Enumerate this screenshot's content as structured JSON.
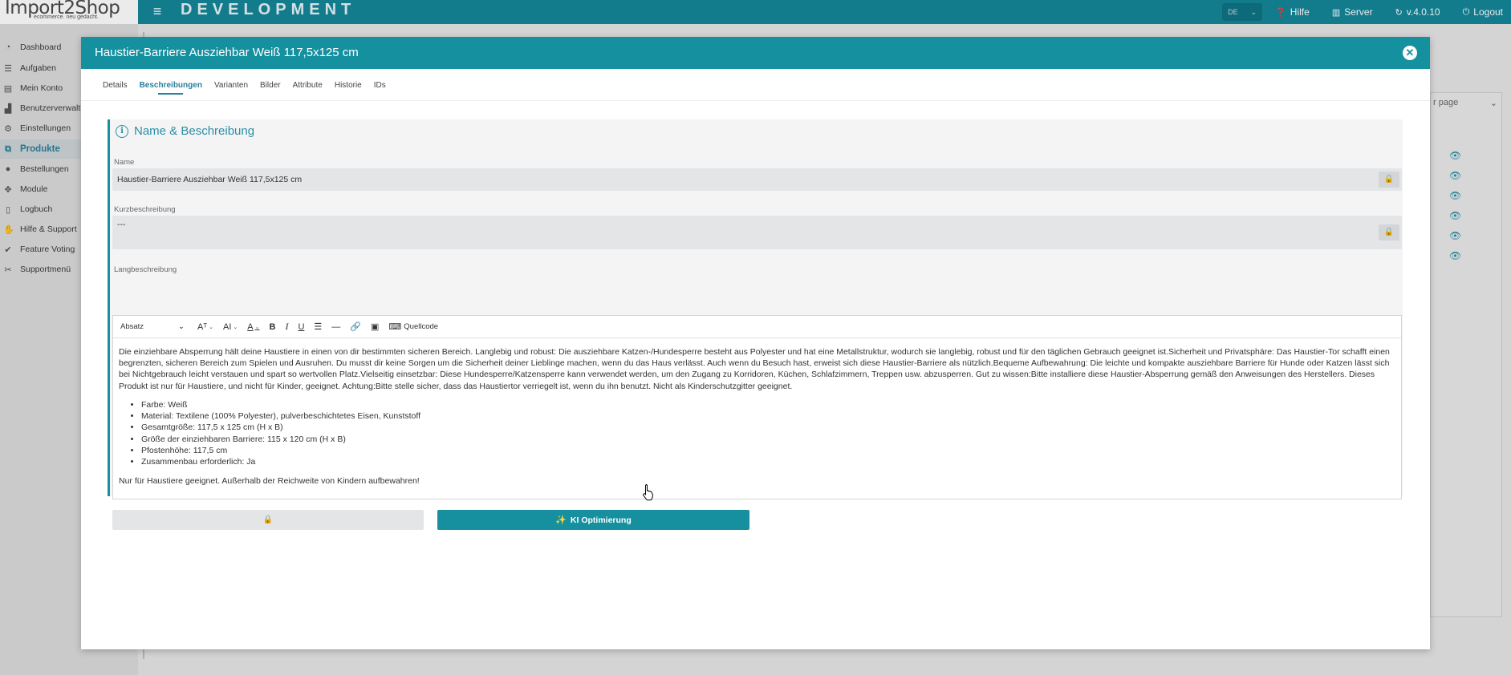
{
  "topbar": {
    "logo": "Import2Shop",
    "logo_tagline": "ecommerce. neu gedacht.",
    "env_title": "DEVELOPMENT",
    "language": "DE",
    "help_label": "Hilfe",
    "server_label": "Server",
    "version_label": "v.4.0.10",
    "logout_label": "Logout"
  },
  "sidebar": {
    "items": [
      {
        "label": "Dashboard",
        "icon": "dashboard-icon"
      },
      {
        "label": "Aufgaben",
        "icon": "list-icon"
      },
      {
        "label": "Mein Konto",
        "icon": "book-icon"
      },
      {
        "label": "Benutzerverwaltung",
        "icon": "users-icon"
      },
      {
        "label": "Einstellungen",
        "icon": "gears-icon"
      },
      {
        "label": "Produkte",
        "icon": "sitemap-icon",
        "active": true
      },
      {
        "label": "Bestellungen",
        "icon": "piggy-bank-icon"
      },
      {
        "label": "Module",
        "icon": "puzzle-icon"
      },
      {
        "label": "Logbuch",
        "icon": "file-icon"
      },
      {
        "label": "Hilfe & Support",
        "icon": "hands-helping-icon"
      },
      {
        "label": "Feature Voting",
        "icon": "vote-icon"
      },
      {
        "label": "Supportmenü",
        "icon": "tools-icon"
      }
    ]
  },
  "background": {
    "per_page_label": "r page"
  },
  "modal": {
    "title": "Haustier-Barriere Ausziehbar Weiß 117,5x125 cm",
    "tabs": [
      "Details",
      "Beschreibungen",
      "Varianten",
      "Bilder",
      "Attribute",
      "Historie",
      "IDs"
    ],
    "active_tab": "Beschreibungen",
    "section_title": "Name & Beschreibung",
    "name_label": "Name",
    "name_value": "Haustier-Barriere Ausziehbar Weiß 117,5x125 cm",
    "short_label": "Kurzbeschreibung",
    "short_value": "---",
    "long_label": "Langbeschreibung",
    "toolbar": {
      "paragraph_format": "Absatz",
      "source_label": "Quellcode"
    },
    "long_paragraph": "Die einziehbare Absperrung hält deine Haustiere in einen von dir bestimmten sicheren Bereich. Langlebig und robust: Die ausziehbare Katzen-/Hundesperre besteht aus Polyester und hat eine Metallstruktur, wodurch sie langlebig, robust und für den täglichen Gebrauch geeignet ist.Sicherheit und Privatsphäre: Das Haustier-Tor schafft einen begrenzten, sicheren Bereich zum Spielen und Ausruhen. Du musst dir keine Sorgen um die Sicherheit deiner Lieblinge machen, wenn du das Haus verlässt. Auch wenn du Besuch hast, erweist sich diese Haustier-Barriere als nützlich.Bequeme Aufbewahrung: Die leichte und kompakte ausziehbare Barriere für Hunde oder Katzen lässt sich bei Nichtgebrauch leicht verstauen und spart so wertvollen Platz.Vielseitig einsetzbar: Diese Hundesperre/Katzensperre kann verwendet werden, um den Zugang zu Korridoren, Küchen, Schlafzimmern, Treppen usw. abzusperren. Gut zu wissen:Bitte installiere diese Haustier-Absperrung gemäß den Anweisungen des Herstellers. Dieses Produkt ist nur für Haustiere, und nicht für Kinder, geeignet. Achtung:Bitte stelle sicher, dass das Haustiertor verriegelt ist, wenn du ihn benutzt. Nicht als Kinderschutzgitter geeignet.",
    "bullets": [
      "Farbe: Weiß",
      "Material: Textilene (100% Polyester), pulverbeschichtetes Eisen, Kunststoff",
      "Gesamtgröße: 117,5 x 125 cm (H x B)",
      "Größe der einziehbaren Barriere: 115 x 120 cm (H x B)",
      "Pfostenhöhe: 117,5 cm",
      "Zusammenbau erforderlich: Ja"
    ],
    "closing_note": "Nur für Haustiere geeignet. Außerhalb der Reichweite von Kindern aufbewahren!",
    "ki_button_label": "KI Optimierung"
  },
  "colors": {
    "brand": "#15909f",
    "accent_text": "#2a8fa6",
    "field_bg": "#e4e5e7"
  }
}
